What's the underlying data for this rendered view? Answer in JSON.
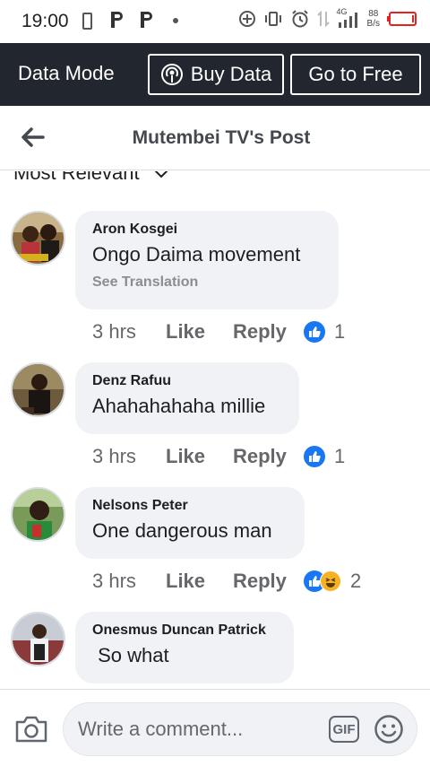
{
  "status_bar": {
    "time": "19:00",
    "net_type": "4G",
    "speed_value": "88",
    "speed_unit": "B/s"
  },
  "data_mode": {
    "title": "Data Mode",
    "buy_label": "Buy Data",
    "free_label": "Go to Free"
  },
  "header": {
    "title": "Mutembei TV's Post"
  },
  "sort": {
    "label": "Most Relevant"
  },
  "comments": [
    {
      "author": "Aron Kosgei",
      "text": "Ongo Daima movement",
      "translation": "See Translation",
      "time": "3 hrs",
      "like": "Like",
      "reply": "Reply",
      "reaction_count": "1",
      "reactions": [
        "like"
      ]
    },
    {
      "author": "Denz Rafuu",
      "text": "Ahahahahaha millie",
      "time": "3 hrs",
      "like": "Like",
      "reply": "Reply",
      "reaction_count": "1",
      "reactions": [
        "like"
      ]
    },
    {
      "author": "Nelsons Peter",
      "text": "One dangerous man",
      "time": "3 hrs",
      "like": "Like",
      "reply": "Reply",
      "reaction_count": "2",
      "reactions": [
        "like",
        "haha"
      ]
    },
    {
      "author": "Onesmus Duncan Patrick",
      "text": " So what"
    }
  ],
  "composer": {
    "placeholder": "Write a comment...",
    "gif_label": "GIF"
  },
  "colors": {
    "data_bar": "#22272f",
    "bubble": "#f0f2f5",
    "like_blue": "#1877f2",
    "secondary_text": "#65676b",
    "battery_red": "#e02424"
  }
}
